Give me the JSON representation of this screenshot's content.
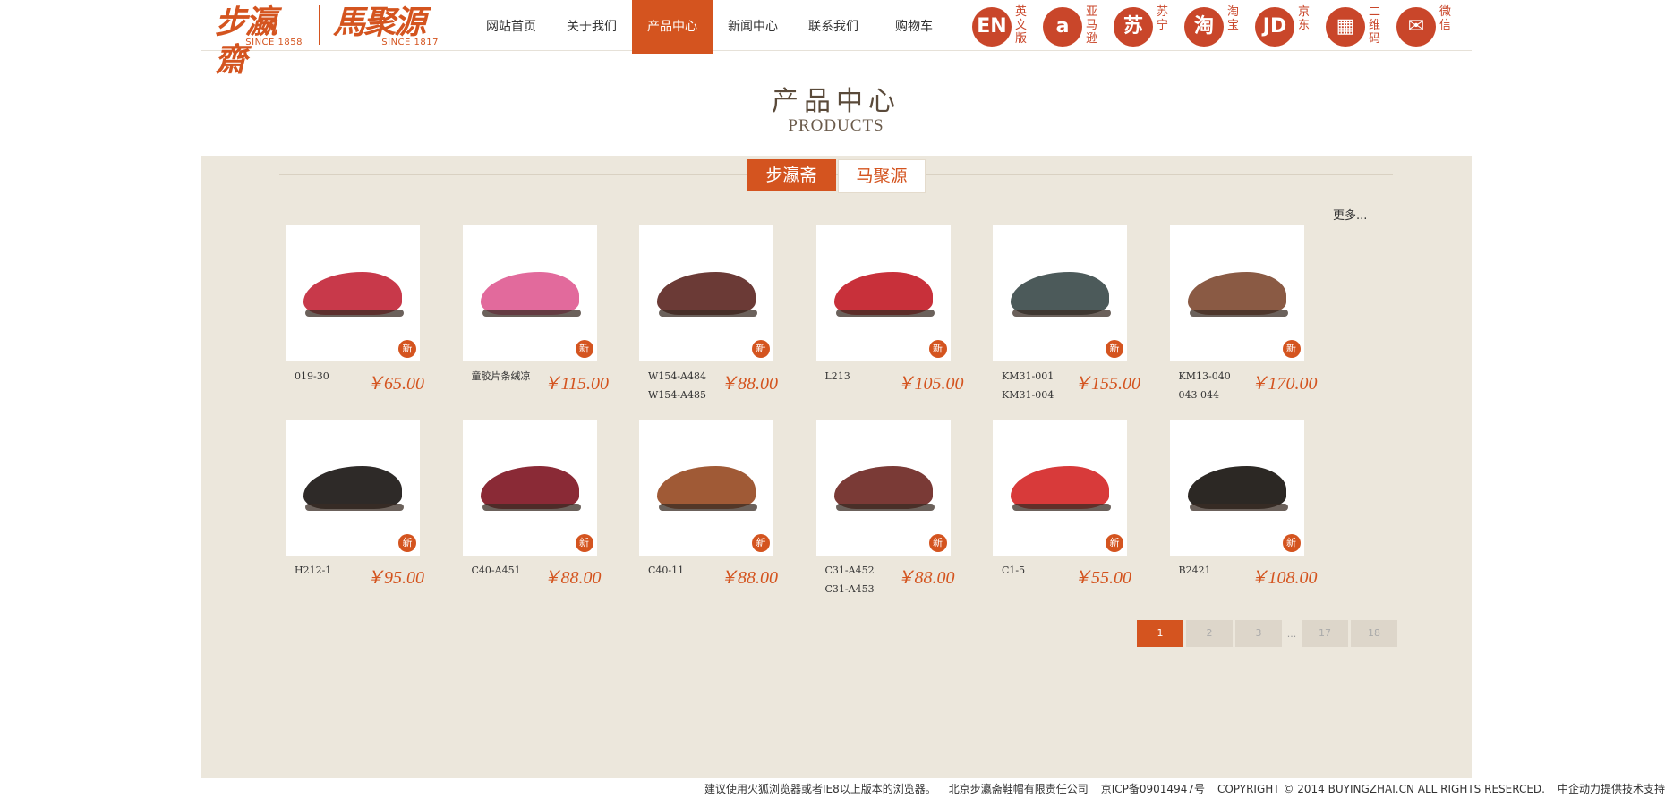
{
  "header": {
    "logo1": {
      "text": "步瀛齋",
      "since": "SINCE 1858"
    },
    "logo2": {
      "text": "馬聚源",
      "since": "SINCE 1817"
    },
    "nav": [
      {
        "label": "网站首页",
        "active": false
      },
      {
        "label": "关于我们",
        "active": false
      },
      {
        "label": "产品中心",
        "active": true
      },
      {
        "label": "新闻中心",
        "active": false
      },
      {
        "label": "联系我们",
        "active": false
      },
      {
        "label": "购物车",
        "active": false
      }
    ],
    "links": [
      {
        "glyph": "EN",
        "label": "英文版",
        "icon": "english-icon"
      },
      {
        "glyph": "a",
        "label": "亚马逊",
        "icon": "amazon-icon"
      },
      {
        "glyph": "苏",
        "label": "苏宁",
        "icon": "suning-icon"
      },
      {
        "glyph": "淘",
        "label": "淘宝",
        "icon": "taobao-icon"
      },
      {
        "glyph": "JD",
        "label": "京东",
        "icon": "jd-icon"
      },
      {
        "glyph": "▦",
        "label": "二维码",
        "icon": "qrcode-icon"
      },
      {
        "glyph": "✉",
        "label": "微信",
        "icon": "wechat-icon"
      }
    ]
  },
  "section": {
    "title_zh": "产品中心",
    "title_en": "PRODUCTS"
  },
  "brand_tabs": [
    {
      "label": "步瀛斋",
      "active": true
    },
    {
      "label": "马聚源",
      "active": false
    }
  ],
  "more_label": "更多...",
  "new_badge": "新",
  "products": [
    {
      "model": "019-30",
      "price": "￥65.00",
      "color": "#c8394a"
    },
    {
      "model": "童胶片条绒凉",
      "price": "￥115.00",
      "color": "#e26a9c"
    },
    {
      "model": "W154-A484 W154-A485",
      "price": "￥88.00",
      "color": "#6b3a36"
    },
    {
      "model": "L213",
      "price": "￥105.00",
      "color": "#c8303a"
    },
    {
      "model": "KM31-001 KM31-004",
      "price": "￥155.00",
      "color": "#4c5a5a"
    },
    {
      "model": "KM13-040 043 044",
      "price": "￥170.00",
      "color": "#8a5a44"
    },
    {
      "model": "H212-1",
      "price": "￥95.00",
      "color": "#2e2a28"
    },
    {
      "model": "C40-A451",
      "price": "￥88.00",
      "color": "#8a2a36"
    },
    {
      "model": "C40-11",
      "price": "￥88.00",
      "color": "#a05a36"
    },
    {
      "model": "C31-A452 C31-A453",
      "price": "￥88.00",
      "color": "#7a3a36"
    },
    {
      "model": "C1-5",
      "price": "￥55.00",
      "color": "#d83a3a"
    },
    {
      "model": "B2421",
      "price": "￥108.00",
      "color": "#2c2824"
    }
  ],
  "pagination": [
    "1",
    "2",
    "3",
    "...",
    "17",
    "18"
  ],
  "footer": [
    "建议使用火狐浏览器或者IE8以上版本的浏览器。",
    "北京步瀛斋鞋帽有限责任公司",
    "京ICP备09014947号",
    "COPYRIGHT © 2014 BUYINGZHAI.CN ALL RIGHTS RESERCED.",
    "中企动力提供技术支持"
  ]
}
